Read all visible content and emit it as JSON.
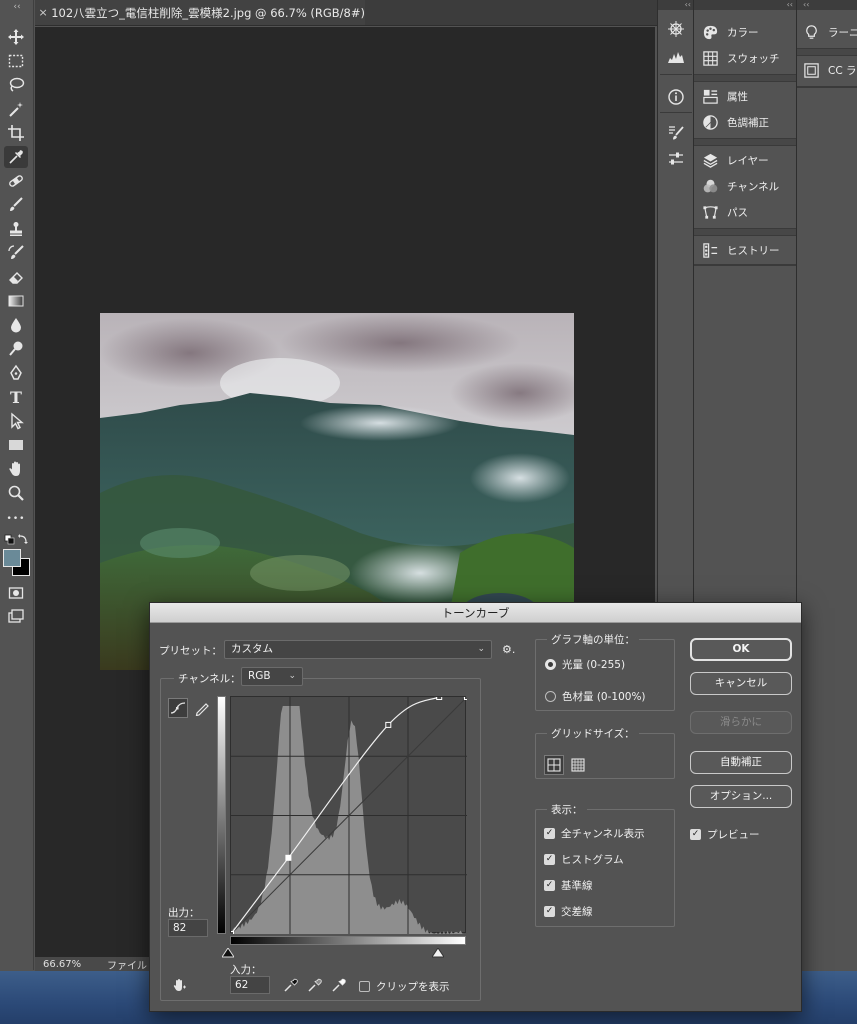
{
  "document": {
    "tab_close": "×",
    "tab_title": "102八雲立つ_電信柱削除_雲模様2.jpg @ 66.7% (RGB/8#)",
    "zoom_status": "66.67%",
    "file_status": "ファイル"
  },
  "toolbar": {
    "grip": "‹‹",
    "tools": [
      "move-tool",
      "marquee-tool",
      "lasso-tool",
      "magic-wand-tool",
      "crop-tool",
      "eyedropper-tool",
      "healing-brush-tool",
      "brush-tool",
      "stamp-tool",
      "history-brush-tool",
      "eraser-tool",
      "gradient-tool",
      "blur-tool",
      "dodge-tool",
      "pen-tool",
      "type-tool",
      "path-selection-tool",
      "rectangle-tool",
      "hand-tool",
      "zoom-tool",
      "more-tools",
      "color-swatches",
      "quick-mask",
      "screen-mode"
    ],
    "type_tool_glyph": "T",
    "more_glyph": "•••",
    "foreground_color": "#6a8a98",
    "background_color": "#000000"
  },
  "panels": {
    "collapse_glyph": "‹‹",
    "items": [
      {
        "icon": "palette-icon",
        "label": "カラー"
      },
      {
        "icon": "swatches-icon",
        "label": "スウォッチ"
      },
      {
        "icon": "properties-icon",
        "label": "属性"
      },
      {
        "icon": "adjustments-icon",
        "label": "色調補正"
      },
      {
        "icon": "layers-icon",
        "label": "レイヤー"
      },
      {
        "icon": "channels-icon",
        "label": "チャンネル"
      },
      {
        "icon": "paths-icon",
        "label": "パス"
      },
      {
        "icon": "history-icon",
        "label": "ヒストリー"
      }
    ],
    "learn": [
      {
        "icon": "lightbulb-icon",
        "label": "ラーニ"
      },
      {
        "icon": "cc-libraries-icon",
        "label": "CC ラ"
      }
    ]
  },
  "curves": {
    "title": "トーンカーブ",
    "preset_label": "プリセット：",
    "preset_value": "カスタム",
    "channel_label": "チャンネル：",
    "channel_value": "RGB",
    "output_label": "出力：",
    "output_value": "82",
    "input_label": "入力：",
    "input_value": "62",
    "clip_label": "クリップを表示",
    "graph_units_legend": "グラフ軸の単位：",
    "units_options": [
      "光量 (0-255)",
      "色材量 (0-100%)"
    ],
    "units_selected": 0,
    "grid_size_legend": "グリッドサイズ：",
    "display_legend": "表示：",
    "display_options": [
      {
        "label": "全チャンネル表示",
        "checked": true
      },
      {
        "label": "ヒストグラム",
        "checked": true
      },
      {
        "label": "基準線",
        "checked": true
      },
      {
        "label": "交差線",
        "checked": true
      }
    ],
    "buttons": {
      "ok": "OK",
      "cancel": "キャンセル",
      "smooth": "滑らかに",
      "auto": "自動補正",
      "options": "オプション..."
    },
    "preview_label": "プレビュー",
    "preview_checked": true,
    "checkmark": "✓",
    "gear_glyph": "⚙.",
    "chevron": "⌄",
    "curve_points": [
      [
        0,
        0
      ],
      [
        62,
        82
      ],
      [
        170,
        225
      ],
      [
        225,
        255
      ],
      [
        255,
        255
      ]
    ]
  }
}
